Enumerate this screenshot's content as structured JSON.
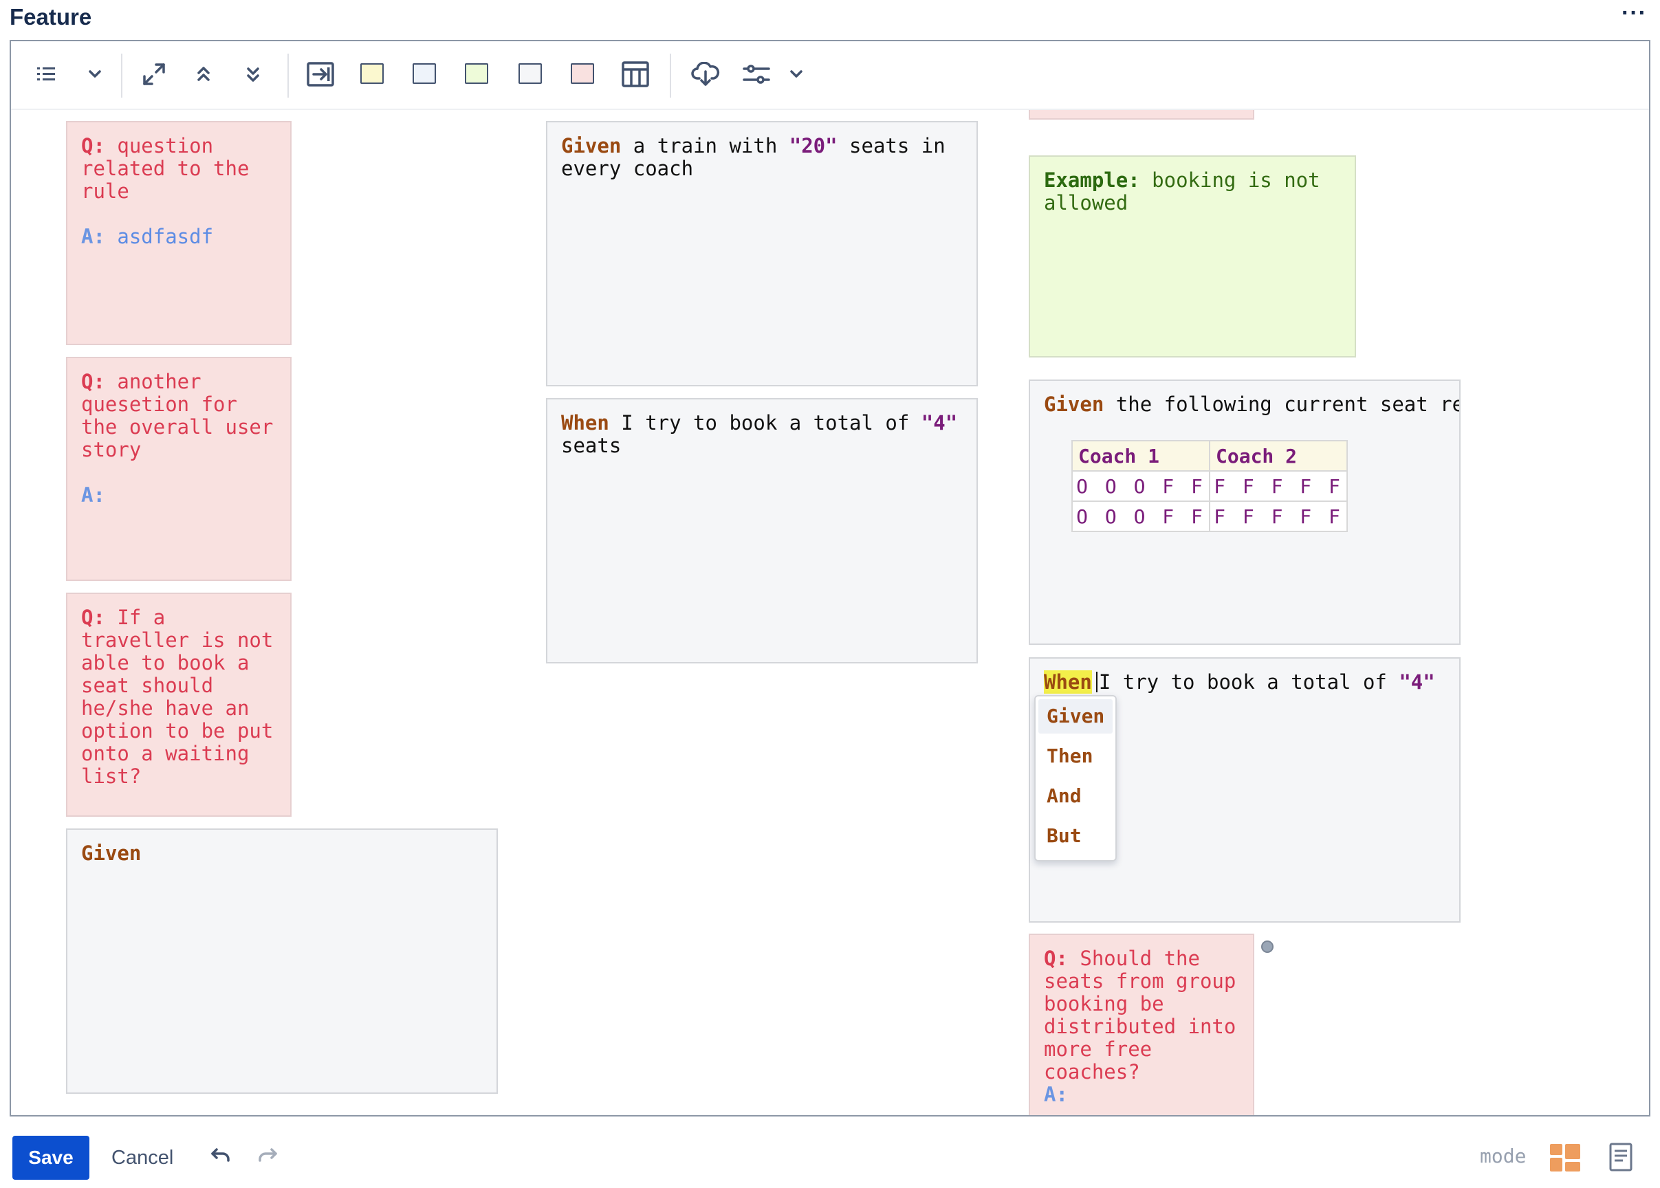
{
  "header": {
    "title": "Feature",
    "more_label": "···"
  },
  "colors": {
    "question": "#f9e1e0",
    "given": "#f5f6f8",
    "example": "#eefbd9",
    "accent": "#0c4fcf"
  },
  "toolbar": {
    "icons": [
      "list-icon",
      "chevron-down-icon",
      "expand-icon",
      "collapse-up-icon",
      "collapse-down-icon",
      "insert-icon",
      "yellow-swatch",
      "blue-swatch",
      "green-swatch",
      "white-swatch",
      "red-swatch",
      "table-icon",
      "cloud-download-icon",
      "sliders-icon",
      "chevron-down-icon"
    ]
  },
  "cards": {
    "q1": {
      "q_label": "Q:",
      "q_text": " question related to the rule",
      "a_label": "A:",
      "a_text": " asdfasdf"
    },
    "q2": {
      "q_label": "Q:",
      "q_text": " another quesetion for the overall user story",
      "a_label": "A:"
    },
    "q3": {
      "q_label": "Q:",
      "q_text": " If a traveller is not able to book a seat should he/she have an option to be put onto a waiting list?"
    },
    "given_empty": {
      "keyword": "Given"
    },
    "given_train": {
      "keyword": "Given",
      "text1": " a train with ",
      "str": "\"20\"",
      "text2": " seats in every coach"
    },
    "when_book": {
      "keyword": "When",
      "text1": " I try to book a total of ",
      "str": "\"4\"",
      "text2": " seats"
    },
    "example": {
      "label": "Example:",
      "text": " booking is not allowed"
    },
    "given_seat": {
      "keyword": "Given",
      "text": " the following current seat re",
      "table": {
        "headers": [
          "Coach 1",
          "Coach 2"
        ],
        "rows": [
          [
            "O O O F F",
            "F F F F F"
          ],
          [
            "O O O F F",
            "F F F F F"
          ]
        ]
      }
    },
    "when_active": {
      "keyword": "When",
      "text1": "I try to book a total of ",
      "str": "\"4\""
    },
    "q4": {
      "q_label": "Q:",
      "q_text": " Should the seats from group booking be distributed into more free coaches?",
      "a_label": "A:"
    }
  },
  "autocomplete": {
    "options": [
      "Given",
      "Then",
      "And",
      "But"
    ],
    "selected": "Given"
  },
  "footer": {
    "save_label": "Save",
    "cancel_label": "Cancel",
    "mode_label": "mode"
  }
}
